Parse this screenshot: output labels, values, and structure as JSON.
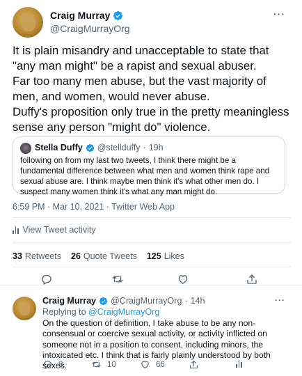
{
  "main_tweet": {
    "author_name": "Craig Murray",
    "author_handle": "@CraigMurrayOrg",
    "more_label": "···",
    "text_lines": [
      "It is plain misandry and unacceptable to state that \"any man might\" be a rapist and sexual abuser.",
      "Far too many men abuse, but the vast majority of men, and women,  would never abuse.",
      "Duffy's proposition only true in the pretty meaningless sense any person \"might do\" violence."
    ],
    "quoted": {
      "author_name": "Stella Duffy",
      "author_handle": "@stellduffy",
      "separator": "·",
      "age": "19h",
      "text": "following on from my last two tweets, I think there might be a fundamental difference between what men and women think rape and sexual abuse are. I think maybe men think it's what other men do. I suspect many women think it's what any man might do."
    },
    "timestamp": "6:59 PM · Mar 10, 2021 · Twitter Web App",
    "activity_label": "View Tweet activity",
    "stats": [
      {
        "count": "33",
        "label": "Retweets"
      },
      {
        "count": "26",
        "label": "Quote Tweets"
      },
      {
        "count": "125",
        "label": "Likes"
      }
    ],
    "action_icons": [
      "reply-icon",
      "retweet-icon",
      "like-icon",
      "share-icon"
    ]
  },
  "reply_tweet": {
    "author_name": "Craig Murray",
    "author_handle": "@CraigMurrayOrg",
    "separator": "·",
    "age": "14h",
    "more_label": "···",
    "replying_prefix": "Replying to",
    "replying_to": "@CraigMurrayOrg",
    "text": "On the question of definition, I take abuse to be any non-consensual or coercive sexual activity, or activity inflicted on someone not in a position to consent, including minors, the intoxicated etc. I think that is fairly plainly understood by both sexes.",
    "counts": {
      "replies": "8",
      "retweets": "10",
      "likes": "66"
    }
  },
  "colors": {
    "verified": "#1d9bf0",
    "link": "#1d9bf0",
    "muted": "#536471",
    "text": "#0f1419",
    "divider": "#e6ecf0"
  }
}
